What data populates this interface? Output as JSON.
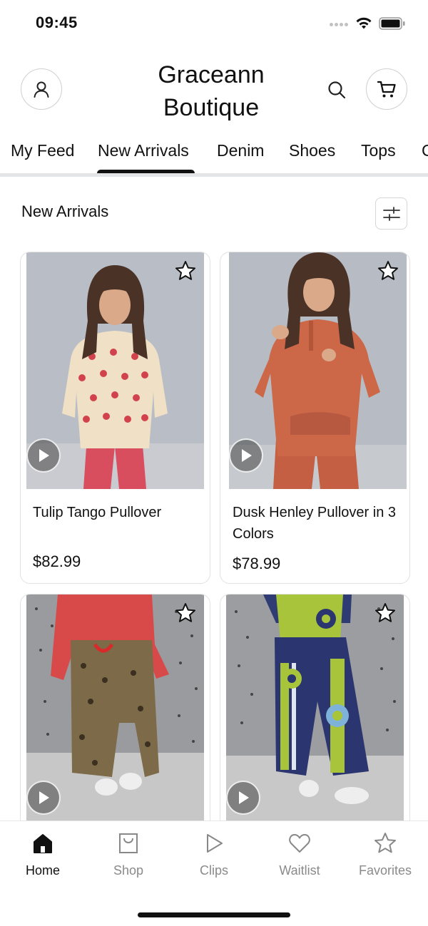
{
  "status_bar": {
    "time": "09:45",
    "icons": [
      "signal-dots-icon",
      "wifi-icon",
      "battery-icon"
    ]
  },
  "header": {
    "brand_line1": "Graceann",
    "brand_line2": "Boutique",
    "icons": [
      "account-icon",
      "search-icon",
      "cart-icon"
    ]
  },
  "tabs": {
    "items": [
      "My Feed",
      "New Arrivals",
      "Denim",
      "Shoes",
      "Tops",
      "C"
    ],
    "selected": "New Arrivals"
  },
  "section": {
    "title": "New Arrivals",
    "filter_icon": "sliders-icon"
  },
  "products": [
    {
      "name": "Tulip Tango Pullover",
      "price": "$82.99"
    },
    {
      "name": "Dusk Henley Pullover in 3 Colors",
      "price": "$78.99"
    },
    {
      "name": "",
      "price": ""
    },
    {
      "name": "",
      "price": ""
    }
  ],
  "bottom_nav": {
    "items": [
      {
        "label": "Home",
        "icon": "home-icon",
        "active": true
      },
      {
        "label": "Shop",
        "icon": "shopping-bag-icon",
        "active": false
      },
      {
        "label": "Clips",
        "icon": "play-icon",
        "active": false
      },
      {
        "label": "Waitlist",
        "icon": "heart-icon",
        "active": false
      },
      {
        "label": "Favorites",
        "icon": "star-icon",
        "active": false
      }
    ]
  },
  "colors": {
    "text": "#111111",
    "muted": "#8a8a8a",
    "tab_underline": "#e3e5e7",
    "card_border": "#e2e2e2"
  }
}
